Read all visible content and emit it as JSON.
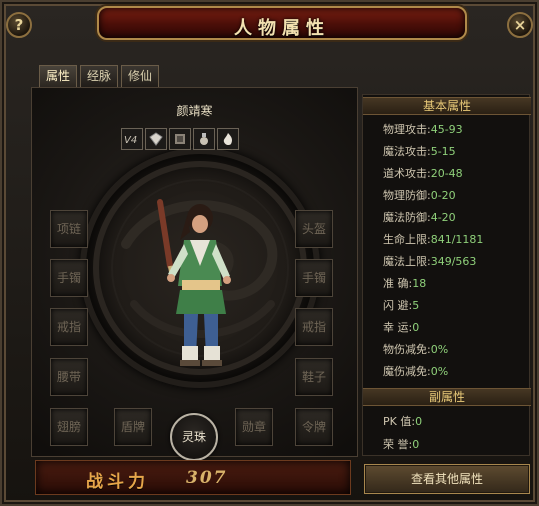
{
  "window": {
    "title": "人物属性"
  },
  "controls": {
    "help_symbol": "?",
    "close_symbol": "×"
  },
  "tabs": [
    {
      "label": "属性",
      "active": true
    },
    {
      "label": "经脉",
      "active": false
    },
    {
      "label": "修仙",
      "active": false
    }
  ],
  "character": {
    "name": "颜靖寒",
    "buffs": [
      "v4-icon",
      "gem-icon",
      "armor-icon",
      "potion-icon",
      "flame-icon"
    ]
  },
  "slots": {
    "necklace": "项链",
    "helmet": "头盔",
    "bracelet_left": "手镯",
    "bracelet_right": "手镯",
    "ring_left": "戒指",
    "ring_right": "戒指",
    "belt": "腰带",
    "boots": "鞋子",
    "wings": "翅膀",
    "shield": "盾牌",
    "medal": "勋章",
    "token": "令牌",
    "spirit_orb": "灵珠"
  },
  "combat_power": {
    "label": "战斗力",
    "value": "307"
  },
  "basic_section": {
    "title": "基本属性",
    "rows": [
      {
        "label": "物理攻击:",
        "value": "45-93"
      },
      {
        "label": "魔法攻击:",
        "value": "5-15"
      },
      {
        "label": "道术攻击:",
        "value": "20-48"
      },
      {
        "label": "物理防御:",
        "value": "0-20"
      },
      {
        "label": "魔法防御:",
        "value": "4-20"
      },
      {
        "label": "生命上限:",
        "value": "841/1181"
      },
      {
        "label": "魔法上限:",
        "value": "349/563"
      },
      {
        "label": "准    确:",
        "value": "18"
      },
      {
        "label": "闪    避:",
        "value": "5"
      },
      {
        "label": "幸    运:",
        "value": "0"
      },
      {
        "label": "物伤减免:",
        "value": "0%"
      },
      {
        "label": "魔伤减免:",
        "value": "0%"
      }
    ]
  },
  "secondary_section": {
    "title": "副属性",
    "rows": [
      {
        "label": "PK    值:",
        "value": "0"
      },
      {
        "label": "荣    誉:",
        "value": "0"
      }
    ]
  },
  "more_button": {
    "label": "查看其他属性"
  },
  "colors": {
    "stat_value": "#8fd07a",
    "title_red": "#7a1f12",
    "gold_border": "#b08a4a"
  }
}
